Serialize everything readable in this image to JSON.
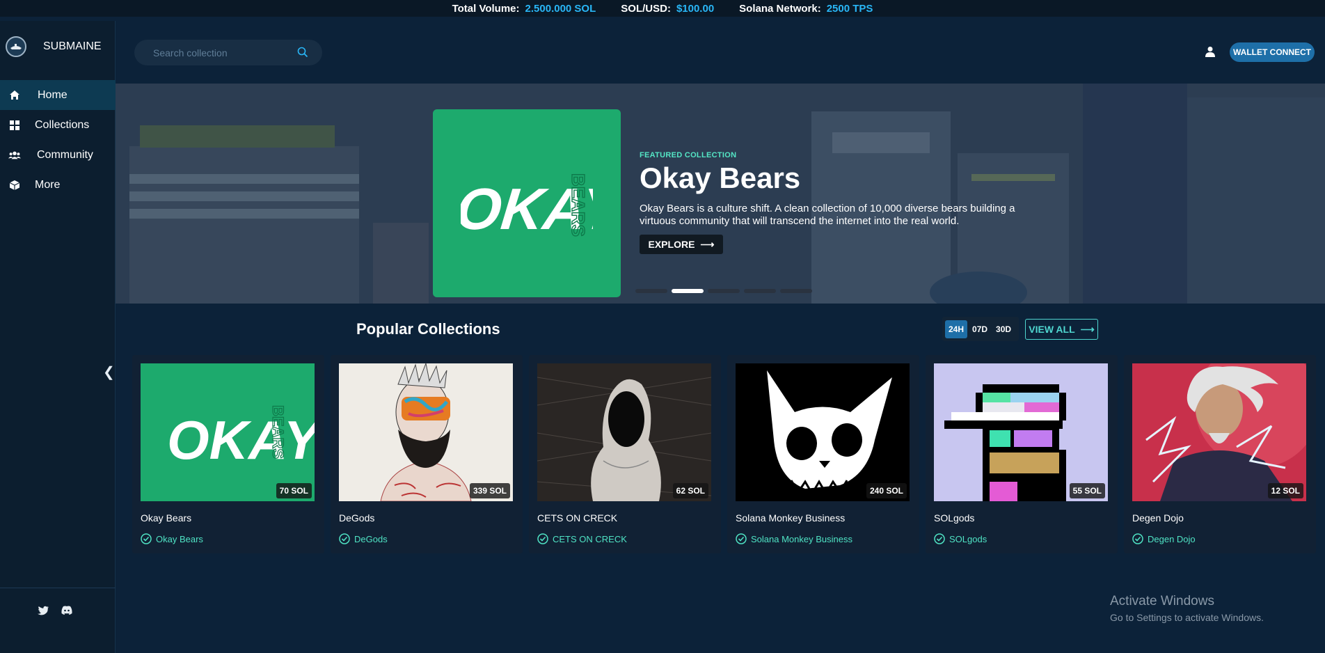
{
  "stats": [
    {
      "label": "Total Volume:",
      "value": "2.500.000 SOL"
    },
    {
      "label": "SOL/USD:",
      "value": "$100.00"
    },
    {
      "label": "Solana Network:",
      "value": "2500 TPS"
    }
  ],
  "sidebar": {
    "brand": "SUBMAINE",
    "items": [
      {
        "label": "Home",
        "icon": "home-icon",
        "active": true
      },
      {
        "label": "Collections",
        "icon": "grid-icon"
      },
      {
        "label": "Community",
        "icon": "users-icon"
      },
      {
        "label": "More",
        "icon": "box-icon"
      }
    ],
    "social": [
      "twitter-icon",
      "discord-icon"
    ]
  },
  "header": {
    "search_placeholder": "Search collection",
    "wallet_label": "WALLET CONNECT"
  },
  "featured": {
    "label": "FEATURED COLLECTION",
    "title": "Okay Bears",
    "description": "Okay Bears is a culture shift. A clean collection of 10,000 diverse bears building a virtuous community that will transcend the internet into the real world.",
    "button": "EXPLORE",
    "logo_main": "OKAY",
    "logo_side": "BEARS",
    "slides": 5,
    "active_slide": 1
  },
  "popular": {
    "title": "Popular Collections",
    "timeframes": [
      "24H",
      "07D",
      "30D"
    ],
    "active_timeframe": "24H",
    "view_all": "VIEW ALL",
    "cards": [
      {
        "name": "Okay Bears",
        "verified": "Okay Bears",
        "price": "70 SOL",
        "art": "okay-bears"
      },
      {
        "name": "DeGods",
        "verified": "DeGods",
        "price": "339 SOL",
        "art": "degods"
      },
      {
        "name": "CETS ON CRECK",
        "verified": "CETS ON CRECK",
        "price": "62 SOL",
        "art": "cets"
      },
      {
        "name": "Solana Monkey Business",
        "verified": "Solana Monkey Business",
        "price": "240 SOL",
        "art": "smb"
      },
      {
        "name": "SOLgods",
        "verified": "SOLgods",
        "price": "55 SOL",
        "art": "solgods"
      },
      {
        "name": "Degen Dojo",
        "verified": "Degen Dojo",
        "price": "12 SOL",
        "art": "degen-dojo"
      }
    ]
  },
  "watermark": {
    "line1": "Activate Windows",
    "line2": "Go to Settings to activate Windows."
  },
  "colors": {
    "accent": "#29b6f6",
    "teal": "#4fe3c4",
    "okay_green": "#1daa6d",
    "wallet": "#1e6fa8"
  }
}
